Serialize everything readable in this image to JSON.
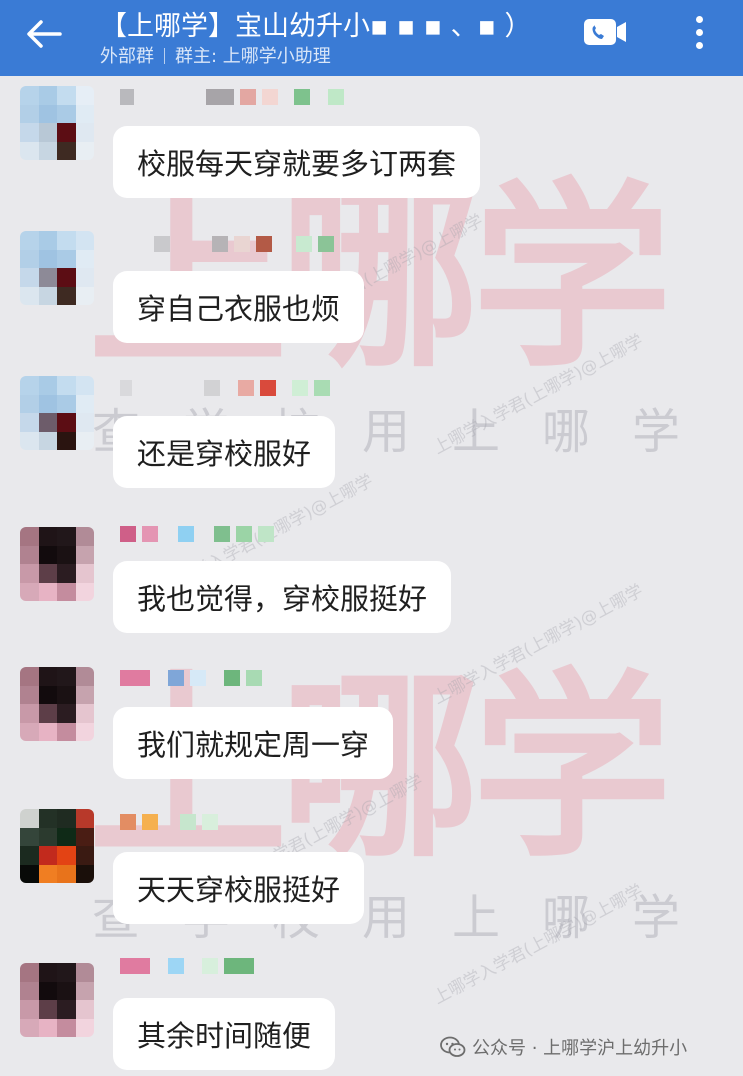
{
  "header": {
    "title": "【上哪学】宝山幼升小▪ ▪ ▪ 、▪ ）",
    "subtitle_external": "外部群",
    "subtitle_owner": "群主: 上哪学小助理",
    "back_icon": "arrow-left-icon",
    "call_icon": "video-call-icon",
    "more_icon": "more-vertical-icon",
    "color": "#3a7bd5"
  },
  "watermark": {
    "big": "上哪学",
    "mid": "查学校用上哪学",
    "diag": "上哪学入学君(上哪学)@上哪学"
  },
  "messages": [
    {
      "text": "校服每天穿就要多订两套"
    },
    {
      "text": "穿自己衣服也烦"
    },
    {
      "text": "还是穿校服好"
    },
    {
      "text": "我也觉得，穿校服挺好"
    },
    {
      "text": "我们就规定周一穿"
    },
    {
      "text": "天天穿校服挺好"
    },
    {
      "text": "其余时间随便"
    }
  ],
  "footer": {
    "text": "公众号 · 上哪学沪上幼升小",
    "icon": "wechat-icon"
  }
}
